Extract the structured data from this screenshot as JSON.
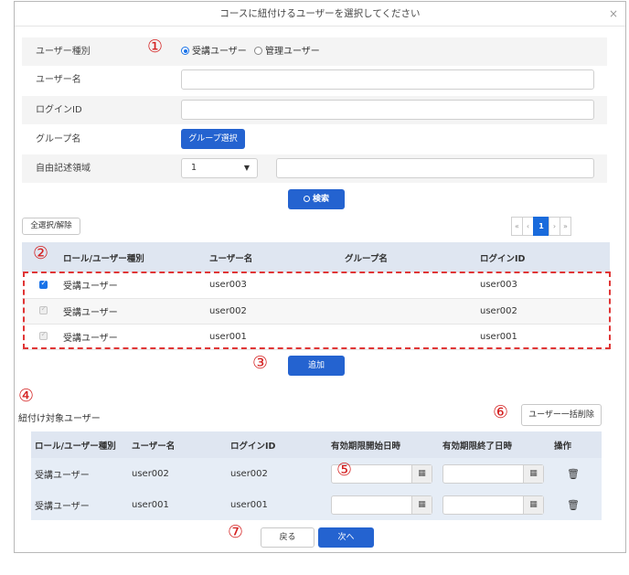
{
  "dialog": {
    "title": "コースに紐付けるユーザーを選択してください",
    "close_glyph": "×"
  },
  "form": {
    "user_type_label": "ユーザー種別",
    "user_type_options": [
      "受講ユーザー",
      "管理ユーザー"
    ],
    "user_type_selected": "受講ユーザー",
    "username_label": "ユーザー名",
    "username_value": "",
    "login_id_label": "ログインID",
    "login_id_value": "",
    "group_label": "グループ名",
    "group_button": "グループ選択",
    "free_field_label": "自由記述領域",
    "free_field_select": "1",
    "free_field_value": "",
    "search_button": "検索",
    "search_icon": "search-icon"
  },
  "list": {
    "select_all_button": "全選択/解除",
    "pagination": {
      "first": "«",
      "prev": "‹",
      "current": "1",
      "next": "›",
      "last": "»"
    },
    "columns": [
      "ロール/ユーザー種別",
      "ユーザー名",
      "グループ名",
      "ログインID"
    ],
    "rows": [
      {
        "checked": true,
        "role": "受講ユーザー",
        "username": "user003",
        "group": "",
        "login_id": "user003"
      },
      {
        "checked": false,
        "role": "受講ユーザー",
        "username": "user002",
        "group": "",
        "login_id": "user002"
      },
      {
        "checked": false,
        "role": "受講ユーザー",
        "username": "user001",
        "group": "",
        "login_id": "user001"
      }
    ],
    "add_button": "追加"
  },
  "targets": {
    "label": "紐付け対象ユーザー",
    "bulk_delete_button": "ユーザー一括削除",
    "columns": [
      "ロール/ユーザー種別",
      "ユーザー名",
      "ログインID",
      "有効期限開始日時",
      "有効期限終了日時",
      "操作"
    ],
    "rows": [
      {
        "role": "受講ユーザー",
        "username": "user002",
        "login_id": "user002",
        "start": "",
        "end": ""
      },
      {
        "role": "受講ユーザー",
        "username": "user001",
        "login_id": "user001",
        "start": "",
        "end": ""
      }
    ]
  },
  "footer": {
    "back_button": "戻る",
    "next_button": "次へ"
  },
  "annotations": [
    "①",
    "②",
    "③",
    "④",
    "⑤",
    "⑥",
    "⑦"
  ],
  "colors": {
    "primary": "#2463d0",
    "annotation": "#d42020",
    "header_bg": "#dfe6f1"
  }
}
